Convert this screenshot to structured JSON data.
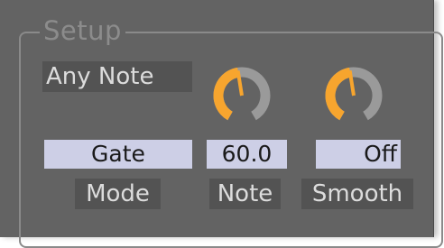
{
  "setup": {
    "title": "Setup",
    "trigger_mode_label": "Any Note",
    "mode": {
      "value": "Gate",
      "label": "Mode"
    },
    "note": {
      "value": "60.0",
      "label": "Note",
      "knob_level": 0.47
    },
    "smooth": {
      "value": "Off",
      "label": "Smooth",
      "knob_level": 0.47
    }
  },
  "colors": {
    "panel": "#636363",
    "knob_accent": "#f7a52e",
    "knob_track": "#9a9a9a",
    "value_field": "#cdcfe6",
    "label_field": "#535353"
  }
}
